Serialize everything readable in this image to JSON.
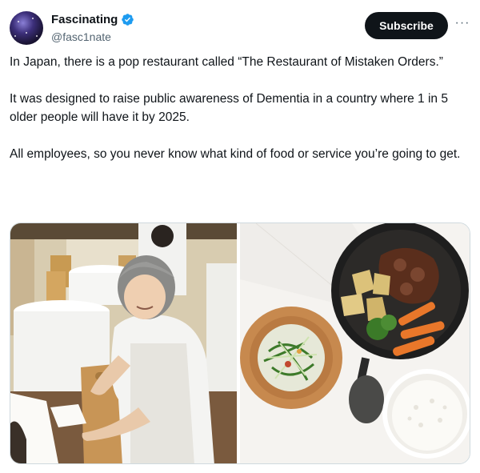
{
  "author": {
    "display_name": "Fascinating",
    "handle": "@fasc1nate",
    "verified": true
  },
  "actions": {
    "subscribe_label": "Subscribe",
    "more_icon": "more-horizontal-icon"
  },
  "tweet": {
    "paragraphs": [
      "In Japan, there is a pop restaurant called “The Restaurant of Mistaken Orders.”",
      "It was designed to raise public awareness of Dementia in a country where 1 in 5 older people will have it by 2025.",
      "All employees, so you never know what kind of food or service you’re going to get."
    ]
  },
  "media": {
    "count": 2
  },
  "colors": {
    "text": "#0f1419",
    "secondary": "#536471",
    "verified": "#1d9bf0",
    "button_bg": "#0f1419"
  }
}
